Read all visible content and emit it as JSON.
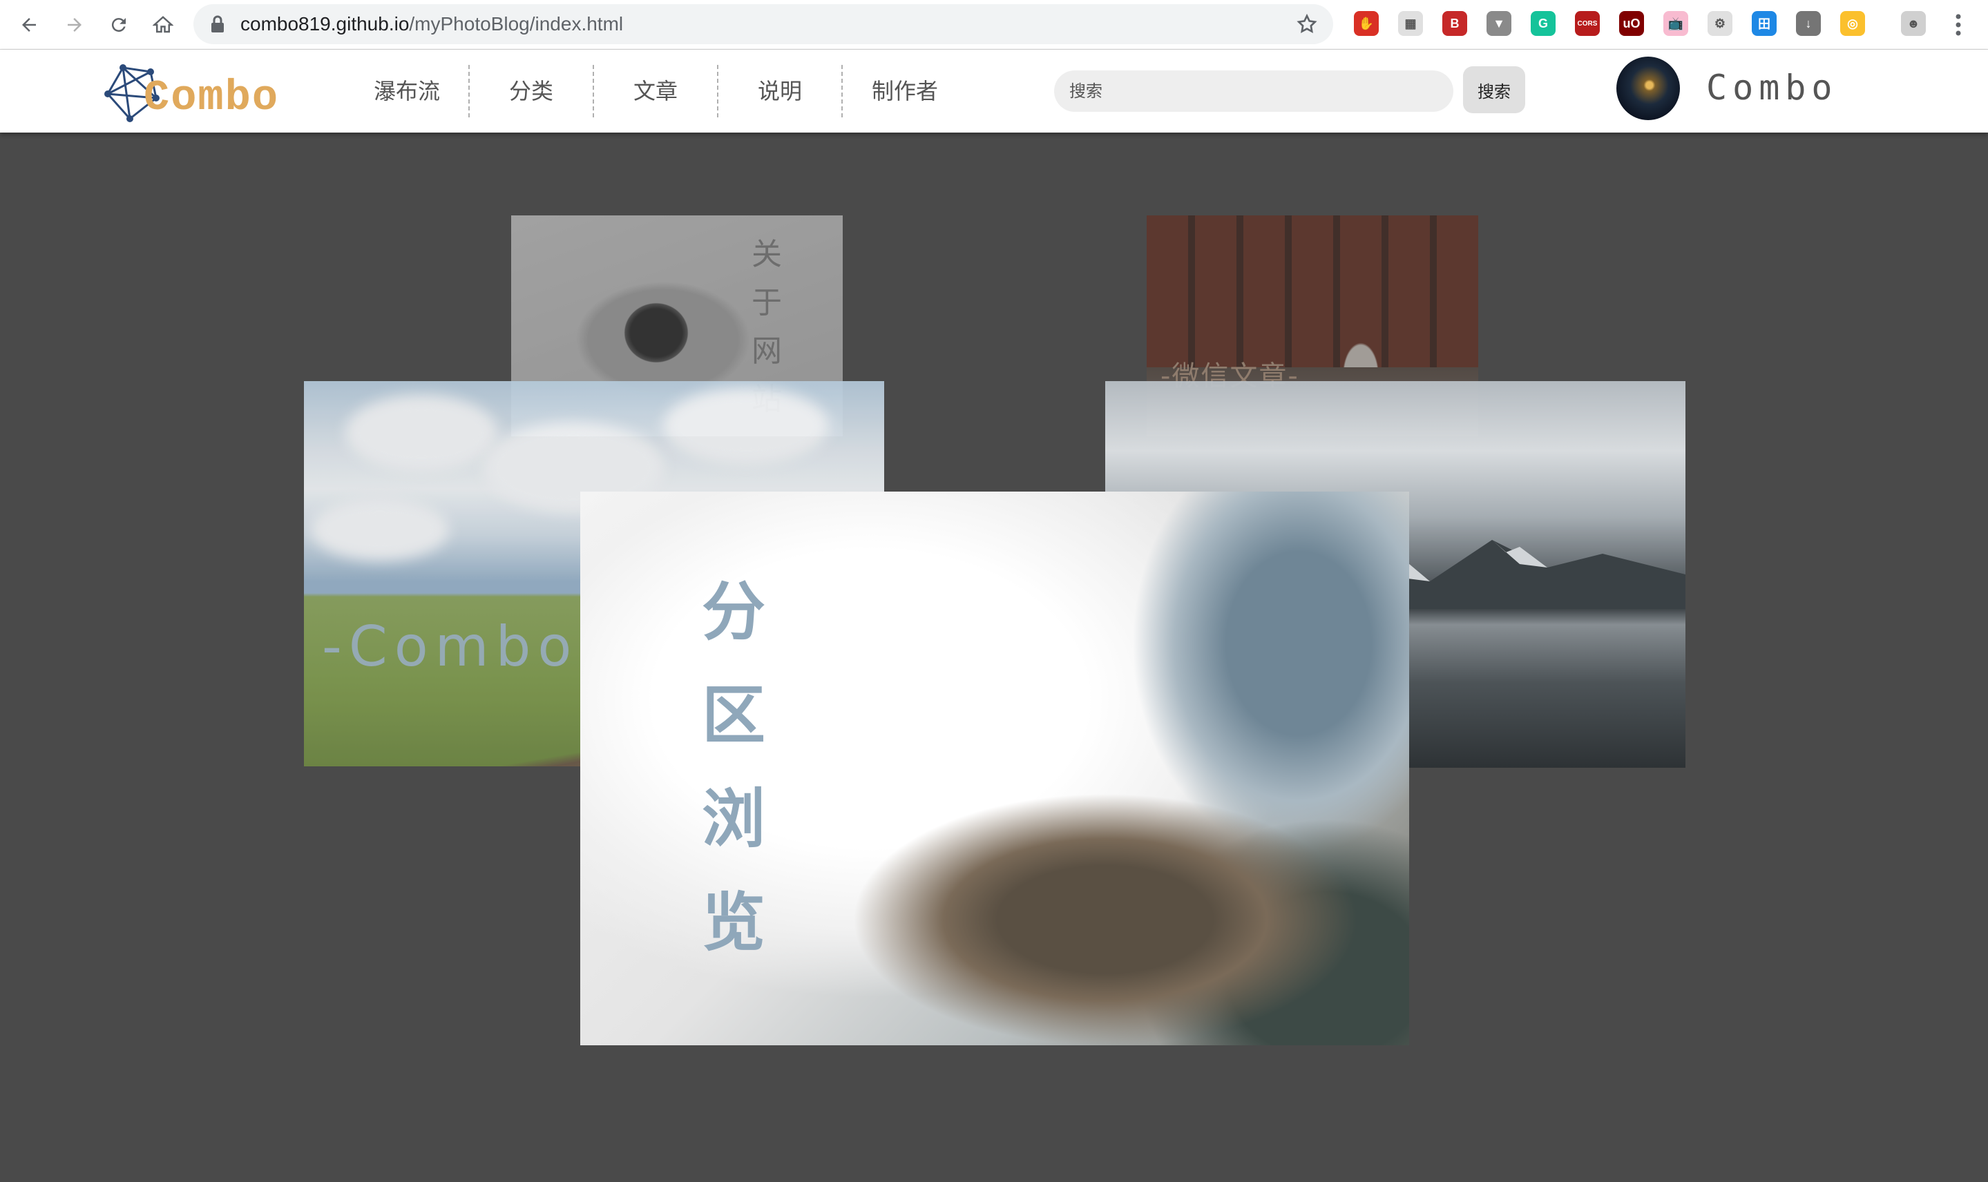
{
  "browser": {
    "url_host": "combo819.github.io",
    "url_path": "/myPhotoBlog/index.html",
    "extensions": [
      {
        "icon": "stop-hand-extension-icon",
        "color": "#d93025",
        "glyph": "✋"
      },
      {
        "icon": "qr-extension-icon",
        "color": "#e0e0e0",
        "glyph": "▦"
      },
      {
        "icon": "b-extension-icon",
        "color": "#c62828",
        "glyph": "B"
      },
      {
        "icon": "vue-devtools-extension-icon",
        "color": "#8a8a8a",
        "glyph": "▼"
      },
      {
        "icon": "grammarly-extension-icon",
        "color": "#15c39a",
        "glyph": "G"
      },
      {
        "icon": "cors-extension-icon",
        "color": "#b71c1c",
        "glyph": "CORS"
      },
      {
        "icon": "ublock-extension-icon",
        "color": "#800000",
        "glyph": "uO"
      },
      {
        "icon": "tv-extension-icon",
        "color": "#f8bbd0",
        "glyph": "📺"
      },
      {
        "icon": "gear-extension-icon",
        "color": "#e0e0e0",
        "glyph": "⚙"
      },
      {
        "icon": "grid-extension-icon",
        "color": "#1e88e5",
        "glyph": "田"
      },
      {
        "icon": "download-extension-icon",
        "color": "#757575",
        "glyph": "↓"
      },
      {
        "icon": "target-extension-icon",
        "color": "#fbc02d",
        "glyph": "◎"
      },
      {
        "icon": "profile-extension-icon",
        "color": "#d0d0d0",
        "glyph": "☻"
      }
    ]
  },
  "header": {
    "logo_text": "Combo",
    "nav": [
      "瀑布流",
      "分类",
      "文章",
      "说明",
      "制作者"
    ],
    "search": {
      "placeholder": "搜索",
      "button_label": "搜索"
    },
    "user_name": "Combo"
  },
  "carousel": {
    "about_text": "关于网站",
    "wechat_text": "-微信文章-",
    "meadow_text": "-Combo-",
    "main_title": "分区浏览"
  }
}
